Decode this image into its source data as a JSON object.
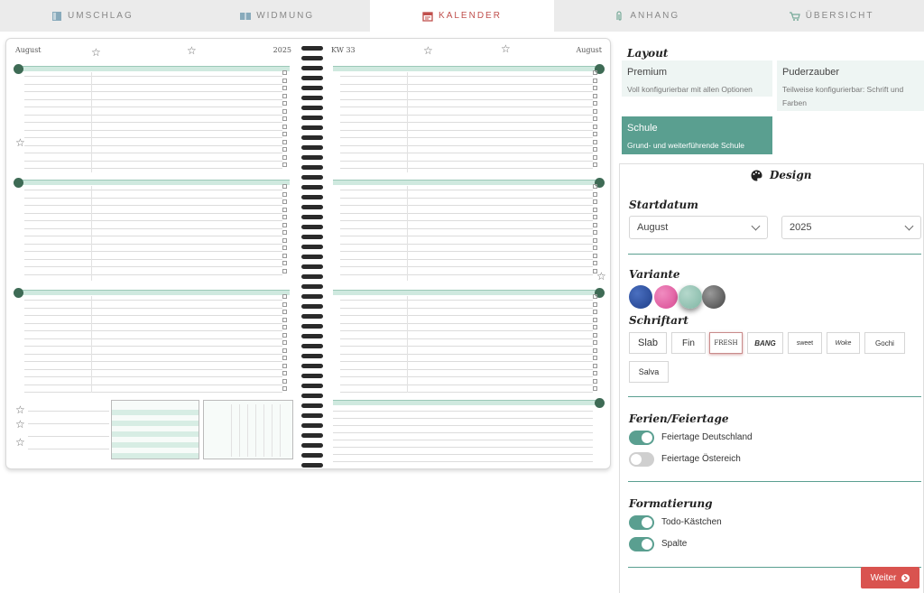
{
  "tabs": [
    {
      "label": "UMSCHLAG",
      "icon": "book-icon",
      "active": false
    },
    {
      "label": "WIDMUNG",
      "icon": "open-book-icon",
      "active": false
    },
    {
      "label": "KALENDER",
      "icon": "calendar-icon",
      "active": true
    },
    {
      "label": "ANHANG",
      "icon": "paperclip-icon",
      "active": false
    },
    {
      "label": "ÜBERSICHT",
      "icon": "cart-icon",
      "active": false
    }
  ],
  "preview": {
    "left_month": "August",
    "left_year": "2025",
    "right_week": "KW 33",
    "right_month": "August"
  },
  "layout": {
    "title": "Layout",
    "options": [
      {
        "name": "Premium",
        "desc": "Voll konfigurierbar mit allen Optionen"
      },
      {
        "name": "Puderzauber",
        "desc": "Teilweise konfigurierbar: Schrift und Farben"
      },
      {
        "name": "Schule",
        "desc": "Grund- und weiterführende Schule"
      }
    ],
    "selected": "Schule"
  },
  "design": {
    "title": "Design",
    "startdatum_title": "Startdatum",
    "month_value": "August",
    "year_value": "2025",
    "variante_title": "Variante",
    "variant_colors": [
      "#1f3f8a",
      "#d94a93",
      "#7fb5a3",
      "#555555"
    ],
    "schriftart_title": "Schriftart",
    "fonts": [
      "Slab",
      "Fin",
      "FRESH",
      "BANG",
      "sweet",
      "Woke",
      "Gochi",
      "Salva"
    ],
    "selected_font": "FRESH",
    "ferien_title": "Ferien/Feiertage",
    "feiertage_de": "Feiertage Deutschland",
    "feiertage_at": "Feiertage Östereich",
    "formatierung_title": "Formatierung",
    "todo": "Todo-Kästchen",
    "spalte": "Spalte"
  },
  "actions": {
    "next_label": "Weiter"
  },
  "colors": {
    "accent": "#5a9f90",
    "danger": "#d9534f",
    "active_tab": "#c0504d"
  }
}
